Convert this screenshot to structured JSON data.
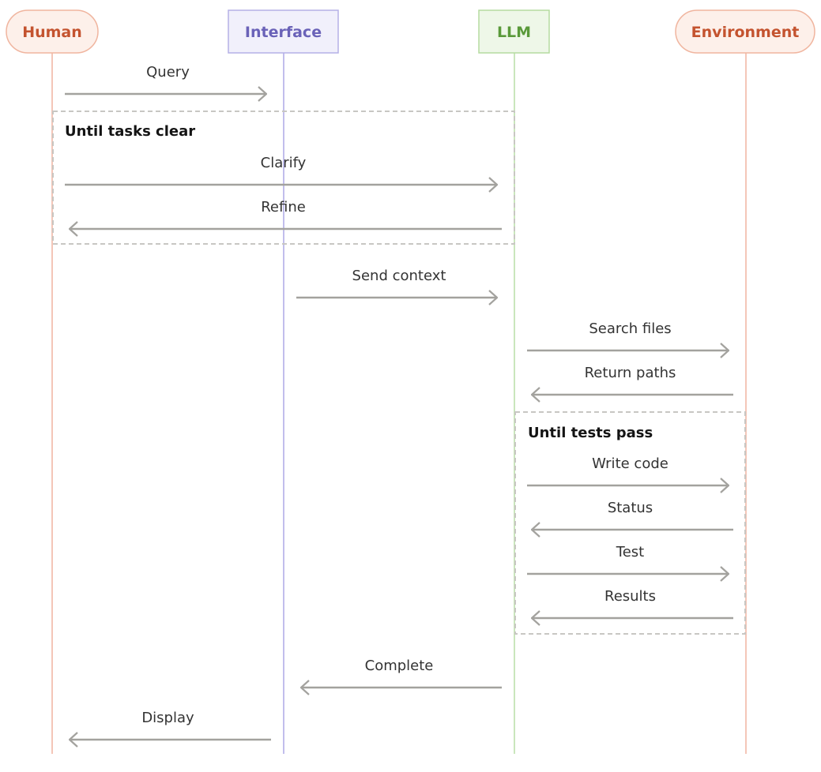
{
  "diagram": {
    "type": "sequence",
    "actors": [
      {
        "id": "human",
        "label": "Human",
        "shape": "pill",
        "text_color": "#c4532f",
        "fill": "#fdf0ea",
        "border": "#f0b59f",
        "line": "#f2b8a6"
      },
      {
        "id": "interface",
        "label": "Interface",
        "shape": "rect",
        "text_color": "#6a62b8",
        "fill": "#f1f0fb",
        "border": "#b5b0e6",
        "line": "#b2aee8"
      },
      {
        "id": "llm",
        "label": "LLM",
        "shape": "rect",
        "text_color": "#5a9a3a",
        "fill": "#eef7e8",
        "border": "#b5dba0",
        "line": "#bde0ab"
      },
      {
        "id": "environment",
        "label": "Environment",
        "shape": "pill",
        "text_color": "#c4532f",
        "fill": "#fdf0ea",
        "border": "#f0b59f",
        "line": "#f2b8a6"
      }
    ],
    "arrow_color": "#a3a29e",
    "frame_color": "#c8c7c3",
    "messages": [
      {
        "label": "Query",
        "from": "human",
        "to": "interface"
      },
      {
        "label": "Clarify",
        "from": "human",
        "to": "llm"
      },
      {
        "label": "Refine",
        "from": "llm",
        "to": "human"
      },
      {
        "label": "Send context",
        "from": "interface",
        "to": "llm"
      },
      {
        "label": "Search files",
        "from": "llm",
        "to": "environment"
      },
      {
        "label": "Return paths",
        "from": "environment",
        "to": "llm"
      },
      {
        "label": "Write code",
        "from": "llm",
        "to": "environment"
      },
      {
        "label": "Status",
        "from": "environment",
        "to": "llm"
      },
      {
        "label": "Test",
        "from": "llm",
        "to": "environment"
      },
      {
        "label": "Results",
        "from": "environment",
        "to": "llm"
      },
      {
        "label": "Complete",
        "from": "llm",
        "to": "interface"
      },
      {
        "label": "Display",
        "from": "interface",
        "to": "human"
      }
    ],
    "frames": [
      {
        "label": "Until tasks clear",
        "from": "human",
        "to": "llm",
        "contains": [
          "Clarify",
          "Refine"
        ]
      },
      {
        "label": "Until tests pass",
        "from": "llm",
        "to": "environment",
        "contains": [
          "Write code",
          "Status",
          "Test",
          "Results"
        ]
      }
    ]
  }
}
